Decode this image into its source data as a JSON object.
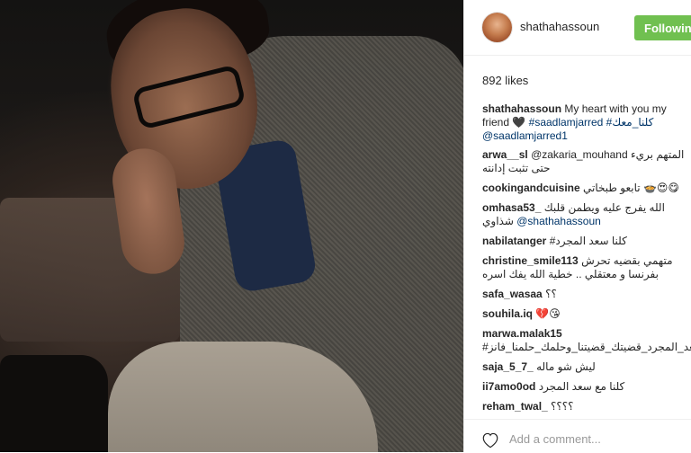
{
  "post": {
    "username": "shathahassoun",
    "follow_label": "Following",
    "likes": "892 likes"
  },
  "caption": {
    "user": "shathahassoun",
    "text": "My heart with you my friend 🖤",
    "tags": "#saadlamjarred #كلنا_معك",
    "mention": "@saadlamjarred1"
  },
  "comments": [
    {
      "user": "arwa__sl",
      "text": "@zakaria_mouhand المتهم بريء حتى تثبت إدانته"
    },
    {
      "user": "cookingandcuisine",
      "text": "تابعو طبخاتي 🍲😍😋"
    },
    {
      "user": "omhasa53_",
      "text": "الله يفرج عليه ويطمن قلبك شذاوي",
      "mention": "@shathahassoun"
    },
    {
      "user": "nabilatanger",
      "text": "#كلنا سعد المجرد"
    },
    {
      "user": "christine_smile113",
      "text": "متهمي بقضيه تحرش بفرنسا و معتقلي .. خطية الله يفك اسره"
    },
    {
      "user": "safa_wasaa",
      "text": "؟؟"
    },
    {
      "user": "souhila.iq",
      "text": "💔😘"
    },
    {
      "user": "marwa.malak15",
      "text": "#كلنا_سعد_المجرد_قضيتك_قضيتنا_وحلمك_حلمنا_فانز"
    },
    {
      "user": "saja_5_7_",
      "text": "ليش شو ماله"
    },
    {
      "user": "ii7amo0od",
      "text": "كلنا مع سعد المجرد"
    },
    {
      "user": "reham_twal_",
      "text": "؟؟؟؟"
    }
  ],
  "footer": {
    "heart_icon": "heart-outline-icon",
    "add_comment_placeholder": "Add a comment..."
  },
  "colors": {
    "follow_button": "#70c050",
    "link": "#003569"
  }
}
